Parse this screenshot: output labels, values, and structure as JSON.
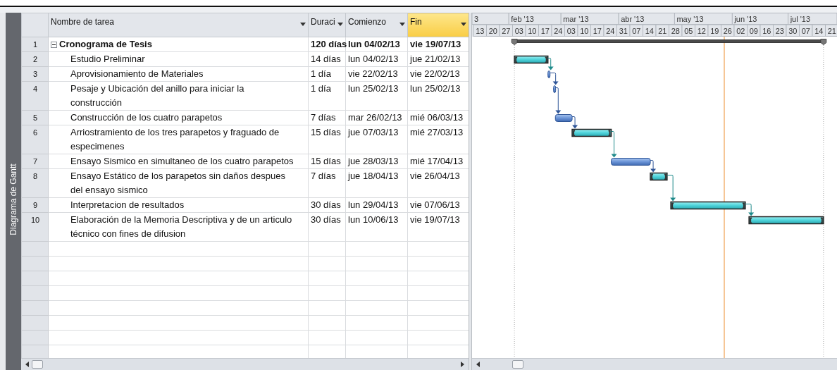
{
  "view_tab": {
    "label": "Diagrama de Gantt"
  },
  "table": {
    "columns": [
      {
        "label": "Nombre de tarea",
        "selected": false
      },
      {
        "label": "Duraci",
        "selected": false
      },
      {
        "label": "Comienzo",
        "selected": false
      },
      {
        "label": "Fin",
        "selected": true
      }
    ],
    "tasks": [
      {
        "id": "1",
        "name": "Cronograma de Tesis",
        "duration": "120 días",
        "start": "lun 04/02/13",
        "finish": "vie 19/07/13",
        "kind": "summary",
        "expanded": true,
        "links_to_next": false,
        "children": [
          {
            "id": "2",
            "name": "Estudio Preliminar",
            "duration": "14 días",
            "start": "lun 04/02/13",
            "finish": "jue 21/02/13",
            "kind": "manual",
            "links_to_next": true
          },
          {
            "id": "3",
            "name": "Aprovisionamiento de Materiales",
            "duration": "1 día",
            "start": "vie 22/02/13",
            "finish": "vie 22/02/13",
            "kind": "auto",
            "links_to_next": true
          },
          {
            "id": "4",
            "name": "Pesaje y Ubicación del anillo para iniciar la construcción",
            "duration": "1 día",
            "start": "lun 25/02/13",
            "finish": "lun 25/02/13",
            "kind": "auto",
            "links_to_next": true
          },
          {
            "id": "5",
            "name": "Construcción de los cuatro parapetos",
            "duration": "7 días",
            "start": "mar 26/02/13",
            "finish": "mié 06/03/13",
            "kind": "auto",
            "links_to_next": true
          },
          {
            "id": "6",
            "name": "Arriostramiento de los tres parapetos y fraguado de especimenes",
            "duration": "15 días",
            "start": "jue 07/03/13",
            "finish": "mié 27/03/13",
            "kind": "manual",
            "links_to_next": true
          },
          {
            "id": "7",
            "name": "Ensayo Sismico en simultaneo de los cuatro parapetos",
            "duration": "15 días",
            "start": "jue 28/03/13",
            "finish": "mié 17/04/13",
            "kind": "auto",
            "links_to_next": true
          },
          {
            "id": "8",
            "name": "Ensayo Estático de los parapetos sin daños despues del ensayo sismico",
            "duration": "7 días",
            "start": "jue 18/04/13",
            "finish": "vie 26/04/13",
            "kind": "manual",
            "links_to_next": true
          },
          {
            "id": "9",
            "name": "Interpretacion de resultados",
            "duration": "30 días",
            "start": "lun 29/04/13",
            "finish": "vie 07/06/13",
            "kind": "manual",
            "links_to_next": true
          },
          {
            "id": "10",
            "name": "Elaboración de la Memoria Descriptiva y de un articulo técnico con fines de difusion",
            "duration": "30 días",
            "start": "lun 10/06/13",
            "finish": "vie 19/07/13",
            "kind": "manual",
            "links_to_next": false
          }
        ]
      }
    ]
  },
  "timescale": {
    "months": [
      "3",
      "feb '13",
      "mar '13",
      "abr '13",
      "may '13",
      "jun '13",
      "jul '13"
    ],
    "weeks": [
      "13",
      "20",
      "27",
      "03",
      "10",
      "17",
      "24",
      "03",
      "10",
      "17",
      "24",
      "31",
      "07",
      "14",
      "21",
      "28",
      "05",
      "12",
      "19",
      "26",
      "02",
      "09",
      "16",
      "23",
      "30",
      "07",
      "14",
      "21"
    ]
  }
}
